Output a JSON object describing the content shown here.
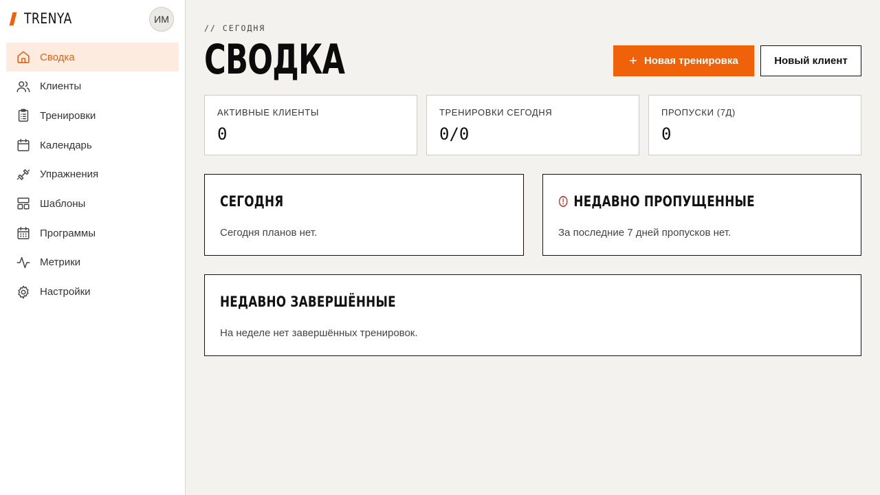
{
  "brand": {
    "name": "TRENYA",
    "accent": "#f0620a"
  },
  "user": {
    "initials": "ИМ"
  },
  "nav": [
    {
      "label": "Сводка",
      "icon": "home-icon",
      "active": true
    },
    {
      "label": "Клиенты",
      "icon": "users-icon"
    },
    {
      "label": "Тренировки",
      "icon": "clipboard-list-icon"
    },
    {
      "label": "Календарь",
      "icon": "calendar-icon"
    },
    {
      "label": "Упражнения",
      "icon": "dumbbell-icon"
    },
    {
      "label": "Шаблоны",
      "icon": "layout-template-icon"
    },
    {
      "label": "Программы",
      "icon": "calendar-grid-icon"
    },
    {
      "label": "Метрики",
      "icon": "activity-icon"
    },
    {
      "label": "Настройки",
      "icon": "gear-icon"
    }
  ],
  "header": {
    "eyebrow": "// СЕГОДНЯ",
    "title": "СВОДКА",
    "primary_button": "Новая тренировка",
    "primary_icon": "plus-icon",
    "secondary_button": "Новый клиент"
  },
  "stats": [
    {
      "label": "АКТИВНЫЕ КЛИЕНТЫ",
      "value": "0"
    },
    {
      "label": "ТРЕНИРОВКИ СЕГОДНЯ",
      "value": "0/0"
    },
    {
      "label": "ПРОПУСКИ (7Д)",
      "value": "0"
    }
  ],
  "panels": {
    "today": {
      "title": "СЕГОДНЯ",
      "text": "Сегодня планов нет."
    },
    "missed": {
      "title": "НЕДАВНО ПРОПУЩЕННЫЕ",
      "text": "За последние 7 дней пропусков нет.",
      "icon": "alert-circle-icon",
      "icon_color": "#c0392b"
    },
    "completed": {
      "title": "НЕДАВНО ЗАВЕРШЁННЫЕ",
      "text": "На неделе нет завершённых тренировок."
    }
  }
}
